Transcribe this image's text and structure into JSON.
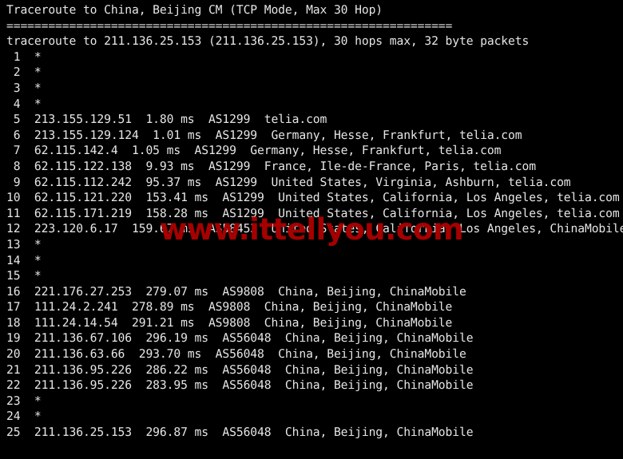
{
  "terminal": {
    "background_color": "#000000",
    "text_color": "#e6e6e6",
    "title_line": "Traceroute to China, Beijing CM (TCP Mode, Max 30 Hop)",
    "separator_line": "================================================================",
    "command_line": "traceroute to 211.136.25.153 (211.136.25.153), 30 hops max, 32 byte packets",
    "target_ip": "211.136.25.153",
    "target_host": "211.136.25.153",
    "max_hops": "30",
    "packet_size": "32 byte packets",
    "mode": "TCP Mode",
    "destination": "China, Beijing CM"
  },
  "watermark": {
    "text": "www.ittellyou.com",
    "color": "#a60000"
  },
  "hops": [
    {
      "num": "1",
      "text": " 1  *"
    },
    {
      "num": "2",
      "text": " 2  *"
    },
    {
      "num": "3",
      "text": " 3  *"
    },
    {
      "num": "4",
      "text": " 4  *"
    },
    {
      "num": "5",
      "text": " 5  213.155.129.51  1.80 ms  AS1299  telia.com"
    },
    {
      "num": "6",
      "text": " 6  213.155.129.124  1.01 ms  AS1299  Germany, Hesse, Frankfurt, telia.com"
    },
    {
      "num": "7",
      "text": " 7  62.115.142.4  1.05 ms  AS1299  Germany, Hesse, Frankfurt, telia.com"
    },
    {
      "num": "8",
      "text": " 8  62.115.122.138  9.93 ms  AS1299  France, Ile-de-France, Paris, telia.com"
    },
    {
      "num": "9",
      "text": " 9  62.115.112.242  95.37 ms  AS1299  United States, Virginia, Ashburn, telia.com"
    },
    {
      "num": "10",
      "text": "10  62.115.121.220  153.41 ms  AS1299  United States, California, Los Angeles, telia.com"
    },
    {
      "num": "11",
      "text": "11  62.115.171.219  158.28 ms  AS1299  United States, California, Los Angeles, telia.com"
    },
    {
      "num": "12",
      "text": "12  223.120.6.17  159.67 ms  AS58453  United States, California, Los Angeles, ChinaMobile"
    },
    {
      "num": "13",
      "text": "13  *"
    },
    {
      "num": "14",
      "text": "14  *"
    },
    {
      "num": "15",
      "text": "15  *"
    },
    {
      "num": "16",
      "text": "16  221.176.27.253  279.07 ms  AS9808  China, Beijing, ChinaMobile"
    },
    {
      "num": "17",
      "text": "17  111.24.2.241  278.89 ms  AS9808  China, Beijing, ChinaMobile"
    },
    {
      "num": "18",
      "text": "18  111.24.14.54  291.21 ms  AS9808  China, Beijing, ChinaMobile"
    },
    {
      "num": "19",
      "text": "19  211.136.67.106  296.19 ms  AS56048  China, Beijing, ChinaMobile"
    },
    {
      "num": "20",
      "text": "20  211.136.63.66  293.70 ms  AS56048  China, Beijing, ChinaMobile"
    },
    {
      "num": "21",
      "text": "21  211.136.95.226  286.22 ms  AS56048  China, Beijing, ChinaMobile"
    },
    {
      "num": "22",
      "text": "22  211.136.95.226  283.95 ms  AS56048  China, Beijing, ChinaMobile"
    },
    {
      "num": "23",
      "text": "23  *"
    },
    {
      "num": "24",
      "text": "24  *"
    },
    {
      "num": "25",
      "text": "25  211.136.25.153  296.87 ms  AS56048  China, Beijing, ChinaMobile"
    }
  ],
  "hop_details": [
    {
      "hop": 1,
      "ip": "*",
      "rtt": "",
      "asn": "",
      "location": ""
    },
    {
      "hop": 2,
      "ip": "*",
      "rtt": "",
      "asn": "",
      "location": ""
    },
    {
      "hop": 3,
      "ip": "*",
      "rtt": "",
      "asn": "",
      "location": ""
    },
    {
      "hop": 4,
      "ip": "*",
      "rtt": "",
      "asn": "",
      "location": ""
    },
    {
      "hop": 5,
      "ip": "213.155.129.51",
      "rtt": "1.80 ms",
      "asn": "AS1299",
      "location": "telia.com"
    },
    {
      "hop": 6,
      "ip": "213.155.129.124",
      "rtt": "1.01 ms",
      "asn": "AS1299",
      "location": "Germany, Hesse, Frankfurt, telia.com"
    },
    {
      "hop": 7,
      "ip": "62.115.142.4",
      "rtt": "1.05 ms",
      "asn": "AS1299",
      "location": "Germany, Hesse, Frankfurt, telia.com"
    },
    {
      "hop": 8,
      "ip": "62.115.122.138",
      "rtt": "9.93 ms",
      "asn": "AS1299",
      "location": "France, Ile-de-France, Paris, telia.com"
    },
    {
      "hop": 9,
      "ip": "62.115.112.242",
      "rtt": "95.37 ms",
      "asn": "AS1299",
      "location": "United States, Virginia, Ashburn, telia.com"
    },
    {
      "hop": 10,
      "ip": "62.115.121.220",
      "rtt": "153.41 ms",
      "asn": "AS1299",
      "location": "United States, California, Los Angeles, telia.com"
    },
    {
      "hop": 11,
      "ip": "62.115.171.219",
      "rtt": "158.28 ms",
      "asn": "AS1299",
      "location": "United States, California, Los Angeles, telia.com"
    },
    {
      "hop": 12,
      "ip": "223.120.6.17",
      "rtt": "159.67 ms",
      "asn": "AS58453",
      "location": "United States, California, Los Angeles, ChinaMobile"
    },
    {
      "hop": 13,
      "ip": "*",
      "rtt": "",
      "asn": "",
      "location": ""
    },
    {
      "hop": 14,
      "ip": "*",
      "rtt": "",
      "asn": "",
      "location": ""
    },
    {
      "hop": 15,
      "ip": "*",
      "rtt": "",
      "asn": "",
      "location": ""
    },
    {
      "hop": 16,
      "ip": "221.176.27.253",
      "rtt": "279.07 ms",
      "asn": "AS9808",
      "location": "China, Beijing, ChinaMobile"
    },
    {
      "hop": 17,
      "ip": "111.24.2.241",
      "rtt": "278.89 ms",
      "asn": "AS9808",
      "location": "China, Beijing, ChinaMobile"
    },
    {
      "hop": 18,
      "ip": "111.24.14.54",
      "rtt": "291.21 ms",
      "asn": "AS9808",
      "location": "China, Beijing, ChinaMobile"
    },
    {
      "hop": 19,
      "ip": "211.136.67.106",
      "rtt": "296.19 ms",
      "asn": "AS56048",
      "location": "China, Beijing, ChinaMobile"
    },
    {
      "hop": 20,
      "ip": "211.136.63.66",
      "rtt": "293.70 ms",
      "asn": "AS56048",
      "location": "China, Beijing, ChinaMobile"
    },
    {
      "hop": 21,
      "ip": "211.136.95.226",
      "rtt": "286.22 ms",
      "asn": "AS56048",
      "location": "China, Beijing, ChinaMobile"
    },
    {
      "hop": 22,
      "ip": "211.136.95.226",
      "rtt": "283.95 ms",
      "asn": "AS56048",
      "location": "China, Beijing, ChinaMobile"
    },
    {
      "hop": 23,
      "ip": "*",
      "rtt": "",
      "asn": "",
      "location": ""
    },
    {
      "hop": 24,
      "ip": "*",
      "rtt": "",
      "asn": "",
      "location": ""
    },
    {
      "hop": 25,
      "ip": "211.136.25.153",
      "rtt": "296.87 ms",
      "asn": "AS56048",
      "location": "China, Beijing, ChinaMobile"
    }
  ]
}
